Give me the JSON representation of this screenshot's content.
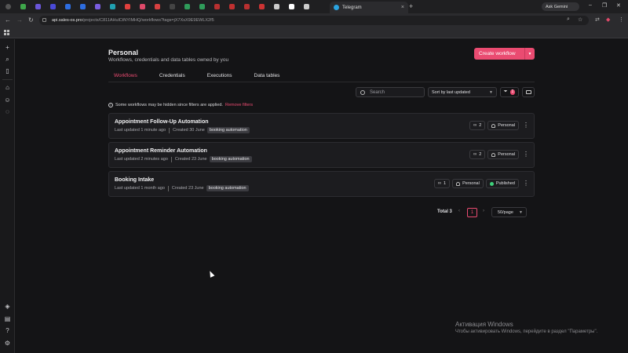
{
  "browser": {
    "active_tab_title": "Telegram",
    "url_host": "api.sales-os.pro",
    "url_path": "/projects/C811AHulCtNYIMHQ/workflows?tags=jX7XsX9E9EWLX2f5",
    "gemini_label": "Ask Gemini",
    "pinned_tab_colors": [
      "#3ea64a",
      "#6a55d8",
      "#4a4ad8",
      "#2d6de0",
      "#2d6de0",
      "#7a5de0",
      "#20a0b0",
      "#e0403d",
      "#e04a6a",
      "#d84040",
      "#444444",
      "#2f9c5a",
      "#2f9c5a",
      "#b83030",
      "#c03030",
      "#b83030",
      "#cc3333",
      "#cccccc",
      "#ffffff",
      "#cccccc",
      "#d03030"
    ]
  },
  "sidebar": {
    "icons": [
      "plus-icon",
      "search-icon",
      "panel-icon",
      "home-icon",
      "user-icon",
      "chat-icon",
      "layers-icon",
      "chart-icon",
      "help-icon",
      "gear-icon"
    ]
  },
  "header": {
    "title": "Personal",
    "subtitle": "Workflows, credentials and data tables owned by you",
    "create_label": "Create workflow"
  },
  "tabs": [
    {
      "label": "Workflows",
      "active": true
    },
    {
      "label": "Credentials",
      "active": false
    },
    {
      "label": "Executions",
      "active": false
    },
    {
      "label": "Data tables",
      "active": false
    }
  ],
  "toolbar": {
    "search_placeholder": "Search",
    "sort_value": "Sort by last updated",
    "filter_count": "1"
  },
  "notice": {
    "text": "Some workflows may be hidden since filters are applied.",
    "link": "Remove filters"
  },
  "workflows": [
    {
      "name": "Appointment Follow-Up Automation",
      "updated": "Last updated 1 minute ago",
      "created": "Created 30 June",
      "tag": "booking automation",
      "links": "2",
      "owner": "Personal",
      "status": ""
    },
    {
      "name": "Appointment Reminder Automation",
      "updated": "Last updated 2 minutes ago",
      "created": "Created 23 June",
      "tag": "booking automation",
      "links": "2",
      "owner": "Personal",
      "status": ""
    },
    {
      "name": "Booking Intake",
      "updated": "Last updated 1 month ago",
      "created": "Created 23 June",
      "tag": "booking automation",
      "links": "1",
      "owner": "Personal",
      "status": "Published"
    }
  ],
  "pagination": {
    "total": "Total 3",
    "current": "1",
    "per_page": "50/page"
  },
  "watermark": {
    "line1": "Активация Windows",
    "line2": "Чтобы активировать Windows, перейдите в раздел \"Параметры\"."
  }
}
